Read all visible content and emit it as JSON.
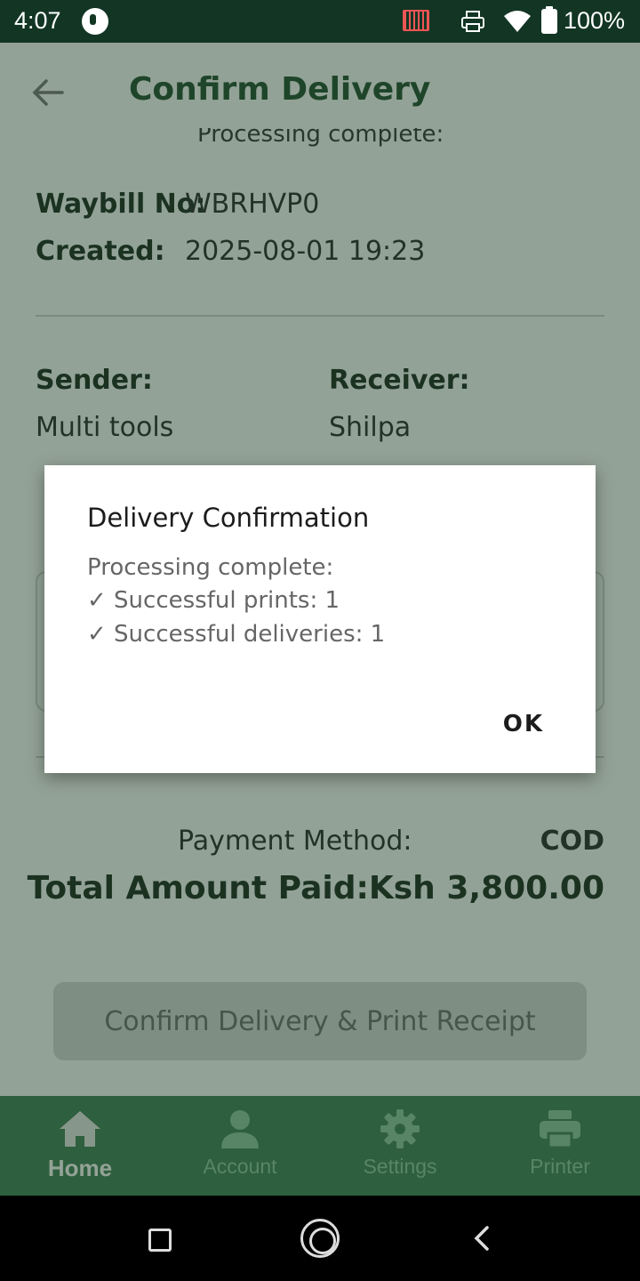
{
  "status_bar": {
    "time": "4:07",
    "battery": "100%",
    "icons": [
      "app-notification-icon",
      "barcode-scanner-icon",
      "printer-icon",
      "wifi-icon",
      "battery-icon"
    ]
  },
  "header": {
    "title": "Confirm Delivery",
    "ghost_text": "Processing complete:"
  },
  "waybill": {
    "label": "Waybill No:",
    "value": "WBRHVP0",
    "created_label": "Created:",
    "created_value": "2025-08-01 19:23"
  },
  "parties": {
    "sender_label": "Sender:",
    "sender_value": "Multi tools",
    "receiver_label": "Receiver:",
    "receiver_value": "Shilpa"
  },
  "payment": {
    "method_label": "Payment Method:",
    "method_value": "COD",
    "total": "Total Amount Paid:Ksh 3,800.00"
  },
  "confirm_button_label": "Confirm Delivery & Print Receipt",
  "bottom_nav": {
    "items": [
      {
        "label": "Home",
        "icon": "home-icon",
        "active": true
      },
      {
        "label": "Account",
        "icon": "account-icon",
        "active": false
      },
      {
        "label": "Settings",
        "icon": "settings-icon",
        "active": false
      },
      {
        "label": "Printer",
        "icon": "printer-icon",
        "active": false
      }
    ]
  },
  "dialog": {
    "title": "Delivery Confirmation",
    "lines": [
      "Processing complete:",
      "✓ Successful prints: 1",
      "✓ Successful deliveries: 1"
    ],
    "ok_label": "OK"
  },
  "colors": {
    "status_bar": "#123524",
    "nav_bar": "#3e7f57",
    "title": "#1f4e30"
  }
}
